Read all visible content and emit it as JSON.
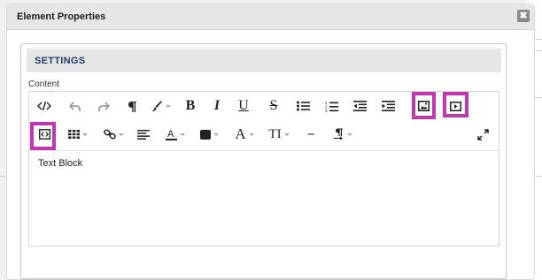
{
  "dialog": {
    "title": "Element Properties",
    "close_symbol": "✖"
  },
  "panel": {
    "title": "SETTINGS"
  },
  "field": {
    "label": "Content"
  },
  "editor": {
    "content": "Text Block"
  },
  "toolbar": {
    "icons": [
      "code-view-icon",
      "undo-icon",
      "redo-icon",
      "paragraph-icon",
      "paint-brush-icon",
      "bold-icon",
      "italic-icon",
      "underline-icon",
      "strikethrough-icon",
      "bulleted-list-icon",
      "numbered-list-icon",
      "outdent-icon",
      "indent-icon",
      "insert-image-icon",
      "insert-video-icon",
      "insert-embed-code-icon",
      "insert-table-icon",
      "insert-link-icon",
      "align-left-icon",
      "font-color-icon",
      "background-color-icon",
      "font-family-icon",
      "font-size-icon",
      "horizontal-line-icon",
      "paragraph-format-icon",
      "fullscreen-icon"
    ],
    "bold": "B",
    "italic": "I",
    "underline": "U",
    "strike": "S",
    "font_family": "A",
    "font_size": "TI",
    "hr": "−",
    "highlight_color": "#c236b1"
  }
}
